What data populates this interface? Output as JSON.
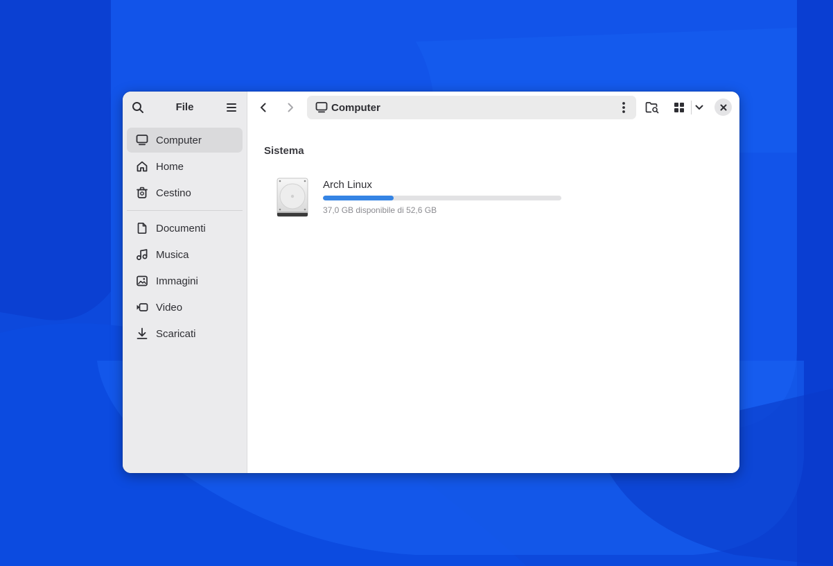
{
  "sidebar": {
    "title": "File",
    "places": [
      {
        "label": "Computer",
        "icon": "computer-icon",
        "active": true
      },
      {
        "label": "Home",
        "icon": "home-icon",
        "active": false
      },
      {
        "label": "Cestino",
        "icon": "trash-icon",
        "active": false
      }
    ],
    "bookmarks": [
      {
        "label": "Documenti",
        "icon": "document-icon"
      },
      {
        "label": "Musica",
        "icon": "music-icon"
      },
      {
        "label": "Immagini",
        "icon": "image-icon"
      },
      {
        "label": "Video",
        "icon": "video-icon"
      },
      {
        "label": "Scaricati",
        "icon": "download-icon"
      }
    ]
  },
  "pathbar": {
    "current": "Computer",
    "icon": "computer-icon"
  },
  "content": {
    "section_title": "Sistema",
    "drives": [
      {
        "name": "Arch Linux",
        "info": "37,0 GB disponibile di 52,6 GB",
        "used_fraction": 0.297,
        "icon": "hard-drive-icon"
      }
    ]
  },
  "colors": {
    "accent": "#3584e4",
    "sidebar_bg": "#ebebed",
    "desktop_bg": "#0f4fe0"
  }
}
